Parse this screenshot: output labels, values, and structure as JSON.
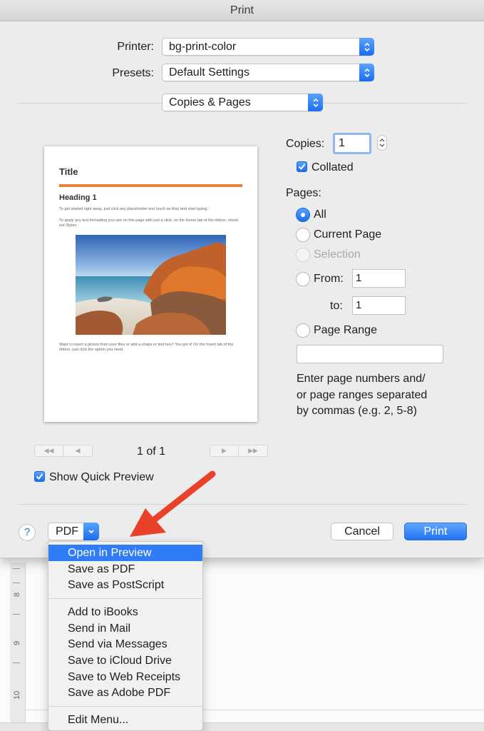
{
  "window": {
    "title": "Print"
  },
  "printer": {
    "label": "Printer:",
    "value": "bg-print-color"
  },
  "presets": {
    "label": "Presets:",
    "value": "Default Settings"
  },
  "section": {
    "value": "Copies & Pages"
  },
  "preview": {
    "title": "Title",
    "heading": "Heading 1",
    "para1": "To get started right away, just click any placeholder text (such as this) and start typing.",
    "para2": "To apply any text formatting you see on this page with just a click, on the Home tab of the ribbon, check out Styles.",
    "para3": "Want to insert a picture from your files or add a shape or text box? You got it! On the Insert tab of the ribbon, just click the option you need.",
    "page_indicator": "1 of 1",
    "nav_first": "◀◀",
    "nav_prev": "◀",
    "nav_next": "▶",
    "nav_last": "▶▶"
  },
  "quick_preview": {
    "label": "Show Quick Preview",
    "checked": true
  },
  "copies": {
    "label": "Copies:",
    "value": "1",
    "collated_label": "Collated",
    "collated": true
  },
  "pages": {
    "label": "Pages:",
    "options": [
      "All",
      "Current Page",
      "Selection",
      "From:",
      "Page Range"
    ],
    "selected": "All",
    "from_value": "1",
    "to_label": "to:",
    "to_value": "1",
    "range_value": "",
    "help_text_1": "Enter page numbers and/",
    "help_text_2": "or page ranges separated",
    "help_text_3": "by commas (e.g. 2, 5-8)"
  },
  "footer": {
    "help": "?",
    "pdf": "PDF",
    "cancel": "Cancel",
    "print": "Print"
  },
  "pdf_menu": {
    "items": [
      "Open in Preview",
      "Save as PDF",
      "Save as PostScript",
      "Add to iBooks",
      "Send in Mail",
      "Send via Messages",
      "Save to iCloud Drive",
      "Save to Web Receipts",
      "Save as Adobe PDF",
      "Edit Menu..."
    ],
    "selected": "Open in Preview"
  },
  "ruler": {
    "labels": [
      "8",
      "9",
      "10"
    ]
  },
  "colors": {
    "accent": "#2f7cf6",
    "arrow": "#e8422b",
    "rule": "#e8823a"
  }
}
